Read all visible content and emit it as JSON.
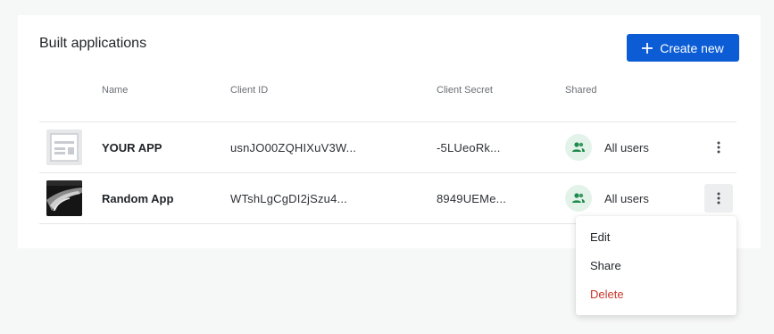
{
  "header": {
    "title": "Built applications",
    "create_label": "Create new"
  },
  "columns": {
    "name": "Name",
    "client_id": "Client ID",
    "client_secret": "Client Secret",
    "shared": "Shared"
  },
  "rows": [
    {
      "name": "YOUR APP",
      "client_id": "usnJO00ZQHIXuV3W...",
      "client_secret": "-5LUeoRk...",
      "shared": "All users",
      "thumbnail": "placeholder-app-icon"
    },
    {
      "name": "Random App",
      "client_id": "WTshLgCgDI2jSzu4...",
      "client_secret": "8949UEMe...",
      "shared": "All users",
      "thumbnail": "app-image"
    }
  ],
  "context_menu": {
    "items": [
      "Edit",
      "Share",
      "Delete"
    ]
  },
  "colors": {
    "primary": "#0b5cd5",
    "danger": "#c9372c",
    "shared_icon": "#1f8a4c",
    "shared_icon_bg": "#e3f3ea"
  },
  "icons": {
    "create": "plus-icon",
    "shared": "users-icon",
    "menu": "more-vertical-icon"
  }
}
